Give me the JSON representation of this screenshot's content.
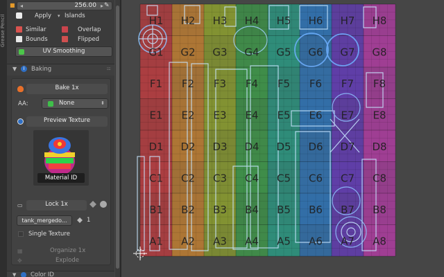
{
  "sidebar": {
    "grease_pencil_tab": "Grease Pencil"
  },
  "panel": {
    "value_field": "256.00",
    "apply_label": "Apply",
    "islands_label": "Islands",
    "similar_label": "Similar",
    "overlap_label": "Overlap",
    "bounds_label": "Bounds",
    "flipped_label": "Flipped",
    "uv_smoothing_label": "UV Smoothing",
    "baking": {
      "title": "Baking",
      "bake_button": "Bake 1x",
      "aa_label": "AA:",
      "aa_value": "None",
      "preview_texture": "Preview Texture",
      "material_id": "Material ID"
    },
    "lock": {
      "label": "Lock 1x",
      "object_name": "tank_mergedo...",
      "object_count": "1",
      "single_texture": "Single Texture",
      "organize": "Organize 1x",
      "explode": "Explode",
      "bottom_label": "Color ID"
    }
  },
  "uv_grid": {
    "rows": [
      "H",
      "G",
      "F",
      "E",
      "D",
      "C",
      "B",
      "A"
    ],
    "cols": [
      "1",
      "2",
      "3",
      "4",
      "5",
      "6",
      "7",
      "8"
    ],
    "column_colors": [
      "#d53a3e",
      "#d98a2e",
      "#9bb22a",
      "#3cab4a",
      "#25a98f",
      "#2a7fd0",
      "#6a3ad0",
      "#c43ab4"
    ]
  }
}
